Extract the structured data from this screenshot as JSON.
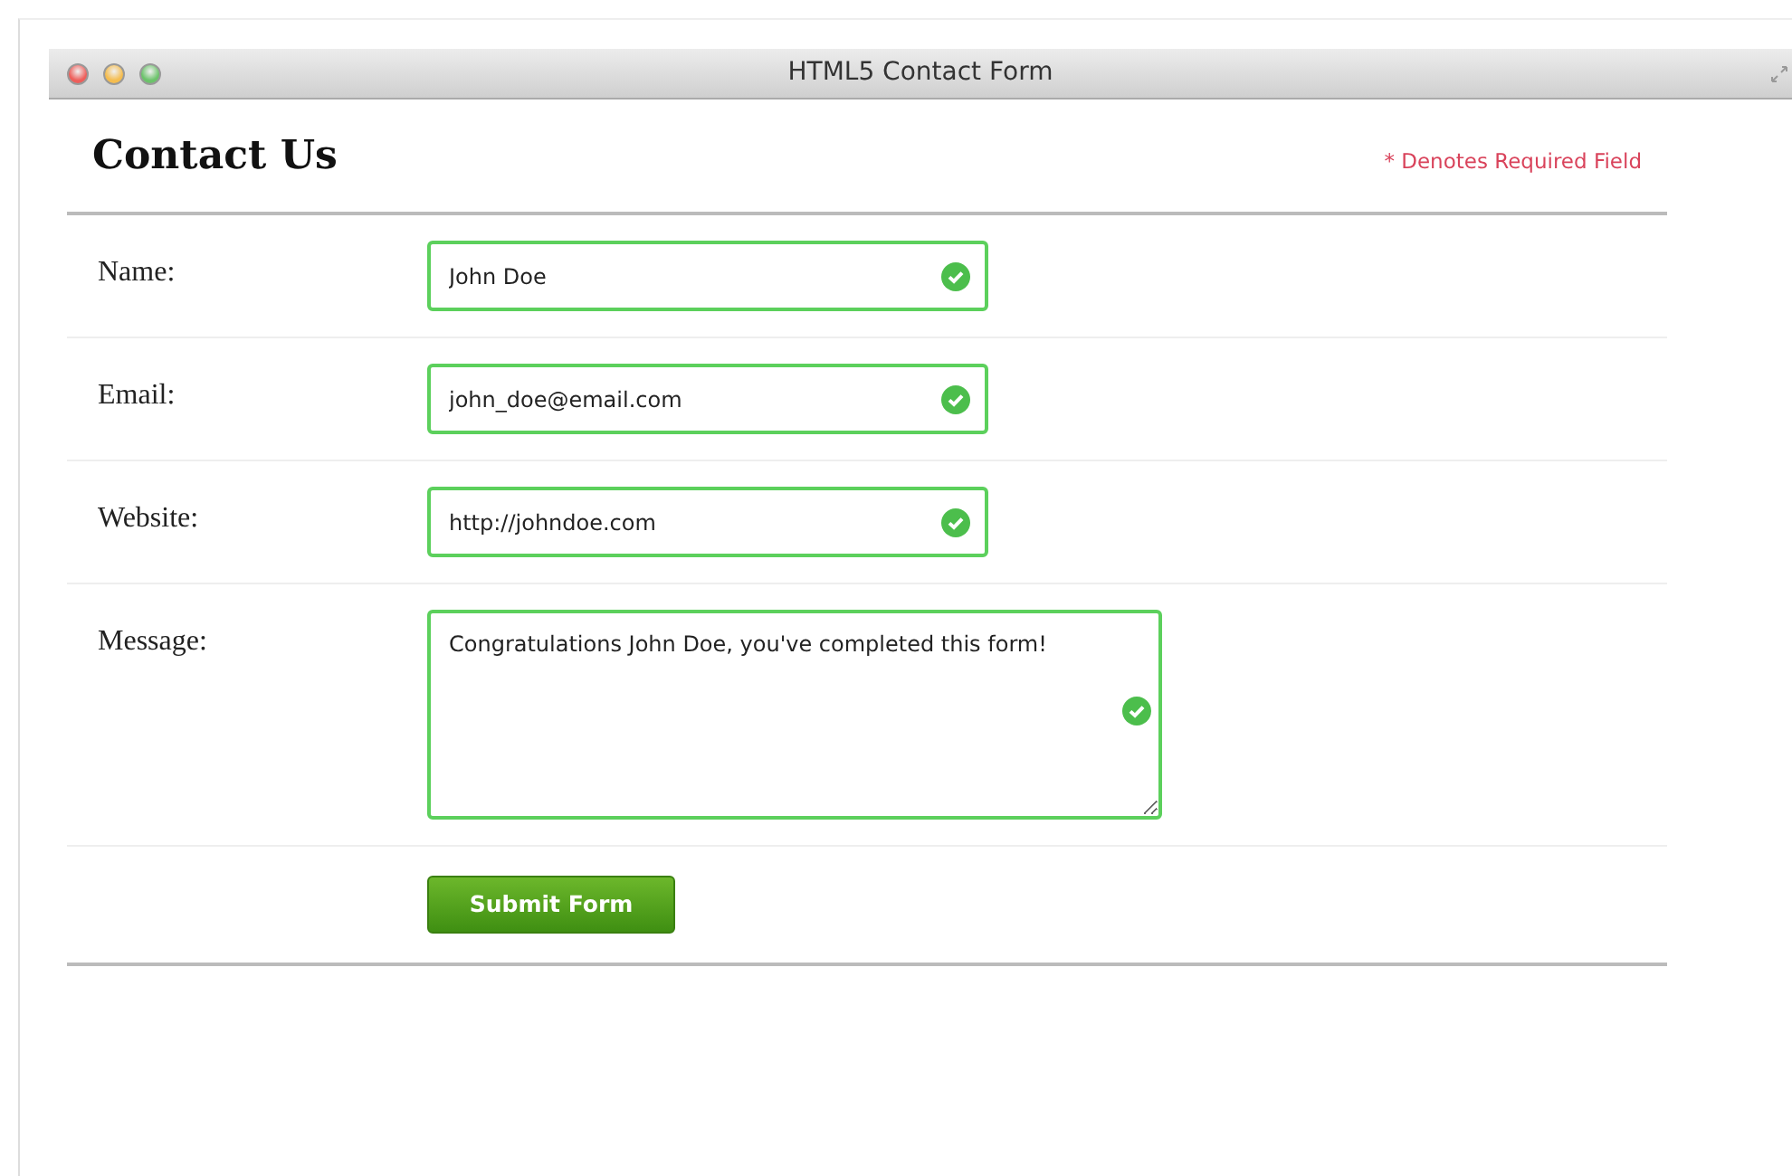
{
  "window": {
    "title": "HTML5 Contact Form"
  },
  "form": {
    "heading": "Contact Us",
    "required_note": "* Denotes Required Field",
    "fields": [
      {
        "label": "Name:",
        "kind": "input",
        "value": "John Doe",
        "valid": true
      },
      {
        "label": "Email:",
        "kind": "input",
        "value": "john_doe@email.com",
        "valid": true
      },
      {
        "label": "Website:",
        "kind": "input",
        "value": "http://johndoe.com",
        "valid": true
      },
      {
        "label": "Message:",
        "kind": "textarea",
        "value": "Congratulations John Doe, you've completed this form!",
        "valid": true
      }
    ],
    "submit": "Submit Form"
  }
}
